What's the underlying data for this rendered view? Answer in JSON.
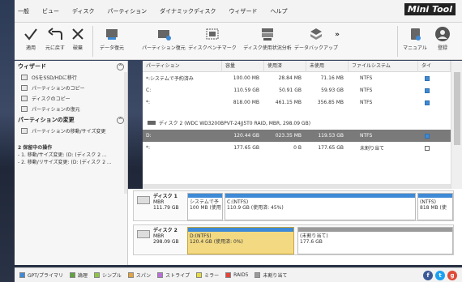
{
  "menu": {
    "items": [
      "一般",
      "ビュー",
      "ディスク",
      "パーティション",
      "ダイナミックディスク",
      "ウィザード",
      "ヘルプ"
    ],
    "logo": "Mini Tool"
  },
  "toolbar": {
    "apply": "適用",
    "undo": "元に戻す",
    "discard": "破棄",
    "data_recovery": "データ復元",
    "partition_recovery": "パーティション復元",
    "disk_benchmark": "ディスクベンチマーク",
    "space_analyzer": "ディスク使用状況分析",
    "backup": "データバックアップ",
    "more": "»",
    "manual": "マニュアル",
    "register": "登録"
  },
  "left": {
    "wizard_title": "ウィザード",
    "wizard_items": [
      "OSをSSD/HDに移行",
      "パーティションのコピー",
      "ディスクのコピー",
      "パーティションの復元"
    ],
    "change_title": "パーティションの変更",
    "change_items": [
      "パーティションの移動/サイズ変更"
    ],
    "pending_title": "2 保留中の操作",
    "pending": [
      "- 1. 移動/サイズ変更: (D: (ディスク 2 ...",
      "- 2. 移動/リサイズ変更: (D: (ディスク 2 ..."
    ]
  },
  "grid": {
    "headers": [
      "パーティション",
      "容量",
      "使用済",
      "未使用",
      "ファイルシステム",
      "タイ"
    ],
    "disk1_rows": [
      {
        "name": "*:システムで予約済み",
        "capacity": "100.00 MB",
        "used": "28.84 MB",
        "unused": "71.16 MB",
        "fs": "NTFS"
      },
      {
        "name": "C:",
        "capacity": "110.59 GB",
        "used": "50.91 GB",
        "unused": "59.93 GB",
        "fs": "NTFS"
      },
      {
        "name": "*:",
        "capacity": "818.00 MB",
        "used": "461.15 MB",
        "unused": "356.85 MB",
        "fs": "NTFS"
      }
    ],
    "disk2_label": "ディスク 2 (WDC WD3200BPVT-24JJ5T0 RAID, MBR, 298.09 GB)",
    "disk2_rows": [
      {
        "name": "D:",
        "capacity": "120.44 GB",
        "used": "023.35 MB",
        "unused": "119.53 GB",
        "fs": "NTFS"
      },
      {
        "name": "*:",
        "capacity": "177.65 GB",
        "used": "0 B",
        "unused": "177.65 GB",
        "fs": "未割り当て"
      }
    ]
  },
  "map": {
    "disk1": {
      "name": "ディスク 1",
      "type": "MBR",
      "size": "111.79 GB",
      "parts": [
        {
          "label": "システムで予",
          "size": "100 MB (使用"
        },
        {
          "label": "C:(NTFS)",
          "size": "110.9 GB (使用済: 45%)"
        },
        {
          "label": "(NTFS)",
          "size": "818 MB (使"
        }
      ]
    },
    "disk2": {
      "name": "ディスク 2",
      "type": "MBR",
      "size": "298.09 GB",
      "parts": [
        {
          "label": "D:(NTFS)",
          "size": "120.4 GB (使用済: 0%)"
        },
        {
          "label": "(未割り当て)",
          "size": "177.6 GB"
        }
      ]
    }
  },
  "legend": [
    "GPT/プライマリ",
    "論理",
    "シンプル",
    "スパン",
    "ストライプ",
    "ミラー",
    "RAID5",
    "未割り当て"
  ],
  "colors": {
    "primary": "#3e8ad6",
    "logical": "#5fa33c",
    "simple": "#8cc63f",
    "spanned": "#e6a23c",
    "striped": "#b86fd6",
    "mirrored": "#e6dc3c",
    "raid5": "#e2453c",
    "unallocated": "#9a9a9a",
    "facebook": "#3b5998",
    "twitter": "#1da1f2",
    "gplus": "#dd4b39"
  },
  "social": {
    "fb": "f",
    "tw": "t",
    "gp": "g"
  }
}
